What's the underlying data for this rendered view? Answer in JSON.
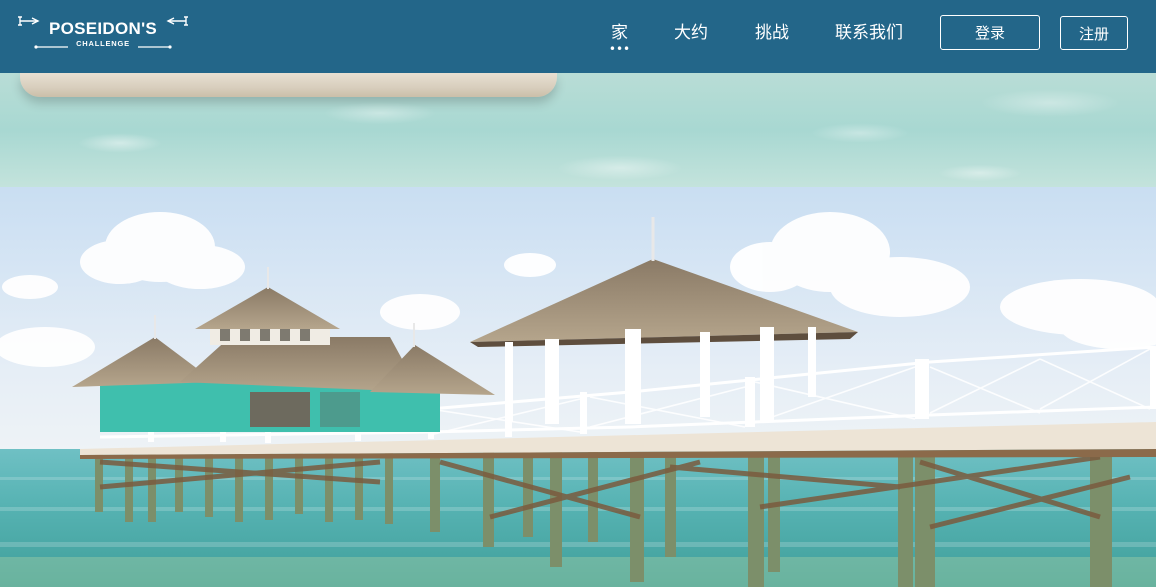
{
  "brand": {
    "logo_main": "POSEIDON'S",
    "logo_sub": "CHALLENGE"
  },
  "nav": {
    "items": [
      {
        "label": "家",
        "active": true
      },
      {
        "label": "大约"
      },
      {
        "label": "挑战"
      },
      {
        "label": "联系我们"
      }
    ],
    "active_indicator": "•••"
  },
  "auth": {
    "login_label": "登录",
    "register_label": "注册"
  },
  "colors": {
    "header_bg": "#236689",
    "text": "#ffffff"
  },
  "hero": {
    "scene": "over-water-pier-with-thatched-gazebos",
    "icon": "photo-icon"
  }
}
